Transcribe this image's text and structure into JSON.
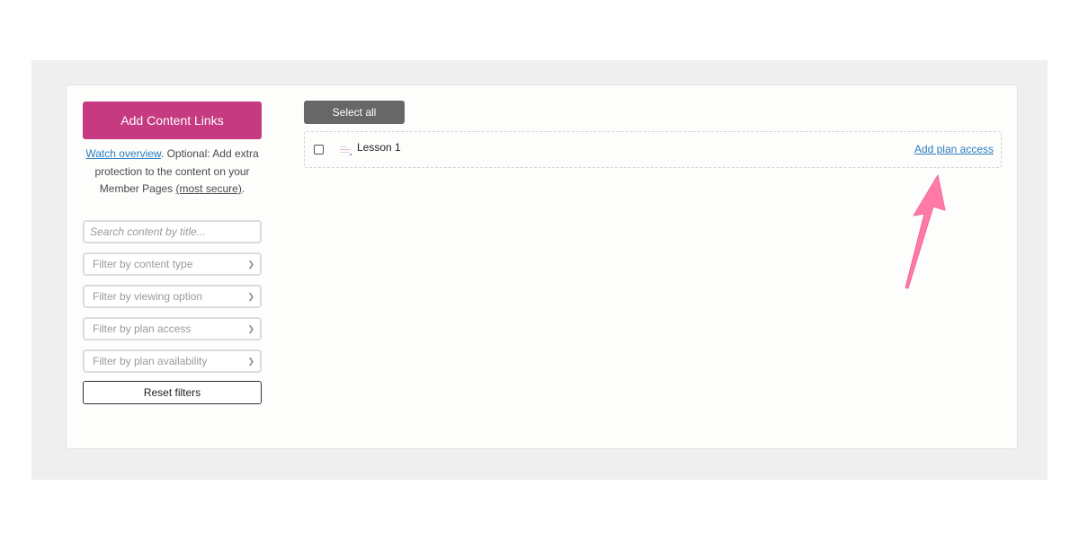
{
  "sidebar": {
    "add_button_label": "Add Content Links",
    "help": {
      "watch_link": "Watch overview",
      "text_1": ". Optional: Add extra protection to the content on your Member Pages ",
      "secure_link": "(most secure)",
      "text_2": "."
    },
    "search": {
      "placeholder": "Search content by title...",
      "value": ""
    },
    "filters": [
      {
        "label": "Filter by content type"
      },
      {
        "label": "Filter by viewing option"
      },
      {
        "label": "Filter by plan access"
      },
      {
        "label": "Filter by plan availability"
      }
    ],
    "reset_label": "Reset filters"
  },
  "main": {
    "select_all_label": "Select all",
    "items": [
      {
        "title": "Lesson 1",
        "checked": false,
        "action_label": "Add plan access",
        "icon": "lesson-icon"
      }
    ]
  },
  "annotation": {
    "type": "arrow",
    "color": "#ff7aa6",
    "points_to": "Add plan access"
  },
  "colors": {
    "brand": "#c63a82",
    "link": "#2a7dc0",
    "select_all_bg": "#676767",
    "outer_bg": "#efefef"
  },
  "icons": {
    "dropdown": "chevron-down-icon"
  }
}
